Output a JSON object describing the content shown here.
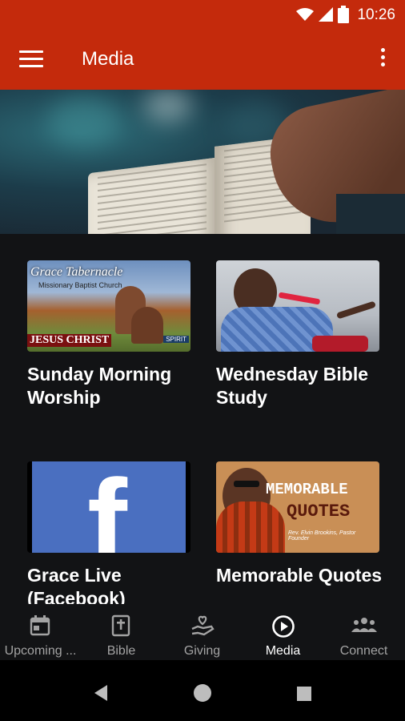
{
  "status": {
    "time": "10:26"
  },
  "appbar": {
    "title": "Media"
  },
  "icons": {
    "menu": "hamburger-menu-icon",
    "overflow": "more-vert-icon"
  },
  "cards": [
    {
      "title": "Sunday Morning Worship",
      "thumb_text": [
        "Grace Tabernacle",
        "Missionary Baptist Church",
        "JESUS CHRIST",
        "SPIRIT"
      ]
    },
    {
      "title": "Wednesday Bible Study"
    },
    {
      "title": "Grace Live (Facebook)",
      "thumb_text": [
        "f"
      ]
    },
    {
      "title": "Memorable Quotes",
      "thumb_text": [
        "MEMORABLE",
        "QUOTES",
        "Rev. Elvin Brookins, Pastor Founder"
      ]
    }
  ],
  "nav": [
    {
      "label": "Upcoming ...",
      "icon": "calendar-icon"
    },
    {
      "label": "Bible",
      "icon": "bible-icon"
    },
    {
      "label": "Giving",
      "icon": "giving-hand-icon"
    },
    {
      "label": "Media",
      "icon": "play-circle-icon",
      "active": true
    },
    {
      "label": "Connect",
      "icon": "group-icon"
    }
  ],
  "colors": {
    "appbar": "#c42a0c",
    "background": "#121315",
    "inactive": "#a3a3a3",
    "active": "#ffffff"
  }
}
